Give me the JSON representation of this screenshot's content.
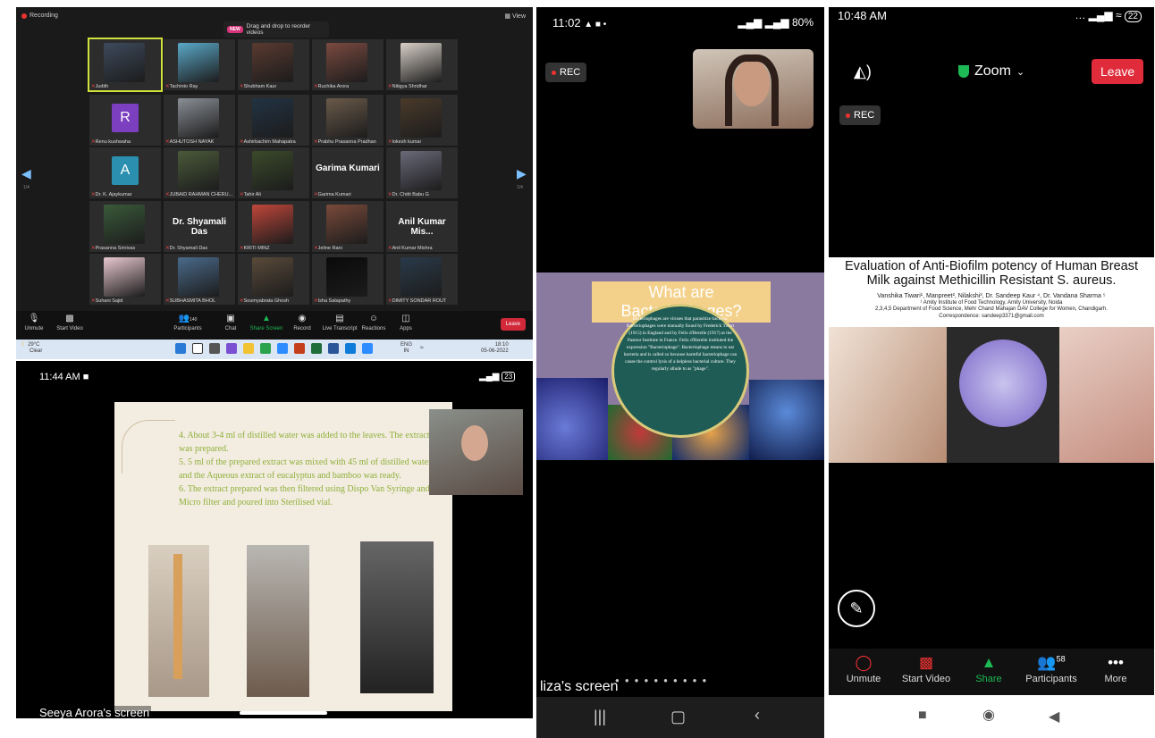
{
  "desktop": {
    "recording_label": "Recording",
    "view_label": "View",
    "drag_badge": "NEW",
    "drag_text": "Drag and drop to reorder videos",
    "page_left": "1/4",
    "page_right": "1/4",
    "tiles": [
      {
        "name": "Judith",
        "big": ""
      },
      {
        "name": "Tachinto Ray",
        "big": ""
      },
      {
        "name": "Shubham Kaur",
        "big": ""
      },
      {
        "name": "Ruchika Arora",
        "big": ""
      },
      {
        "name": "Nitigya Shridhar",
        "big": ""
      },
      {
        "name": "Renu kushwaha",
        "big": "R"
      },
      {
        "name": "ASHUTOSH NAYAK",
        "big": ""
      },
      {
        "name": "Ashirbachim Mahapatra",
        "big": ""
      },
      {
        "name": "Prabhu Prasanna Pradhan",
        "big": ""
      },
      {
        "name": "lokesh kumar",
        "big": ""
      },
      {
        "name": "Dr. K. Ajaykumar",
        "big": "A"
      },
      {
        "name": "JUBAID RAHMAN CHERU...",
        "big": ""
      },
      {
        "name": "Tahir Ali",
        "big": ""
      },
      {
        "name": "Garima Kumari",
        "big": "Garima Kumari"
      },
      {
        "name": "Dr. Chitti Babu G",
        "big": ""
      },
      {
        "name": "Prasanna Srinivas",
        "big": ""
      },
      {
        "name": "Dr. Shyamali Das",
        "big": "Dr. Shyamali Das"
      },
      {
        "name": "KRITI MINZ",
        "big": ""
      },
      {
        "name": "Jeline Rani",
        "big": ""
      },
      {
        "name": "Anil Kumar Mishra",
        "big": "Anil Kumar Mis..."
      },
      {
        "name": "Suhani Sajid",
        "big": ""
      },
      {
        "name": "SUBHASMITA BHOL",
        "big": ""
      },
      {
        "name": "Soumyabrata Ghosh",
        "big": ""
      },
      {
        "name": "Isha Satapathy",
        "big": ""
      },
      {
        "name": "DIMITY SONDAR ROUT",
        "big": ""
      }
    ],
    "toolbar": {
      "unmute": "Unmute",
      "start_video": "Start Video",
      "participants": "Participants",
      "participants_count": "140",
      "chat": "Chat",
      "share_screen": "Share Screen",
      "record": "Record",
      "live_transcript": "Live Transcript",
      "reactions": "Reactions",
      "apps": "Apps",
      "leave": "Leave"
    },
    "taskbar": {
      "weather_temp": "29°C",
      "weather_desc": "Clear",
      "lang": "ENG",
      "region": "IN",
      "time": "18:10",
      "date": "05-06-2022"
    }
  },
  "phone_landscape": {
    "time": "11:44 AM",
    "battery": "23",
    "slide_text": [
      "4. About 3-4 ml of distilled water was added to the leaves. The extract was prepared.",
      "5. 5 ml of the prepared extract was mixed with 45 ml of distilled water and the Aqueous extract of eucalyptus and bamboo was ready.",
      "6. The extract prepared was then filtered using Dispo Van Syringe and Micro filter and poured into Sterilised vial."
    ],
    "screen_label": "Seeya Arora's screen"
  },
  "phone_mid": {
    "time": "11:02",
    "battery": "80%",
    "rec_label": "REC",
    "slide_title": "What are Bacteriophages?",
    "slide_body": "Bacteriophages are viruses that parasitize bacteria. Bacteriophages were mutually found by Frederick Twort (1915) in England and by Felix d'Herelle (1917) at the Pasteur Institute in France. Felix d'Herelle instituted the expression \"Bacteriophage\". Bacteriophage means to eat bacteria and is called so because harmful bacteriophage can cause the control lysis of a helpless bacterial culture. They regularly allude to as \"phage\".",
    "screen_label": "liza's screen"
  },
  "phone_right": {
    "time": "10:48 AM",
    "battery": "22",
    "app_label": "Zoom",
    "leave": "Leave",
    "rec_label": "REC",
    "poster_title": "Evaluation of Anti-Biofilm potency of Human Breast Milk against Methicillin Resistant S. aureus.",
    "poster_authors": "Vanshika Tiwari¹, Manpreet², Nilakshi³, Dr. Sandeep Kaur ⁴, Dr. Vandana Sharma ⁵",
    "poster_affil1": "¹ Amity Institute of Food Technology, Amity University, Noida",
    "poster_affil2": "2,3,4,5 Department of Food Science, Mehr Chand Mahajan DAV College for Women, Chandigarh.",
    "poster_corr": "Correspondence: sandeep3371@gmail.com",
    "toolbar": {
      "unmute": "Unmute",
      "start_video": "Start Video",
      "share": "Share",
      "participants": "Participants",
      "participants_count": "58",
      "more": "More"
    }
  },
  "colors": {
    "leave": "#e02b3b",
    "share_green": "#1db954",
    "active_speaker": "#cfe13a"
  }
}
